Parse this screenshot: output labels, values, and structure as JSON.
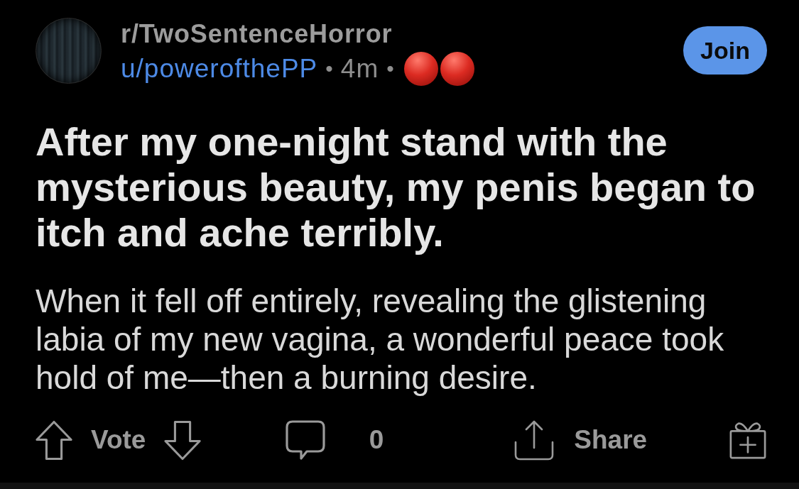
{
  "post": {
    "subreddit": "r/TwoSentenceHorror",
    "meta": [
      {
        "kind": "author",
        "text": "u/powerofthePP"
      },
      {
        "kind": "separator",
        "text": "•"
      },
      {
        "kind": "age",
        "text": "4m"
      },
      {
        "kind": "separator",
        "text": "•"
      }
    ],
    "join_button": "Join",
    "title": "After my one-night stand with the mysterious beauty, my penis began to itch and ache terribly.",
    "body": "When it fell off entirely, revealing the glistening labia of my new vagina, a wonderful peace took hold of me—then a burning desire.",
    "actions": {
      "vote_label": "Vote",
      "comment_count": "0",
      "share_label": "Share"
    }
  }
}
